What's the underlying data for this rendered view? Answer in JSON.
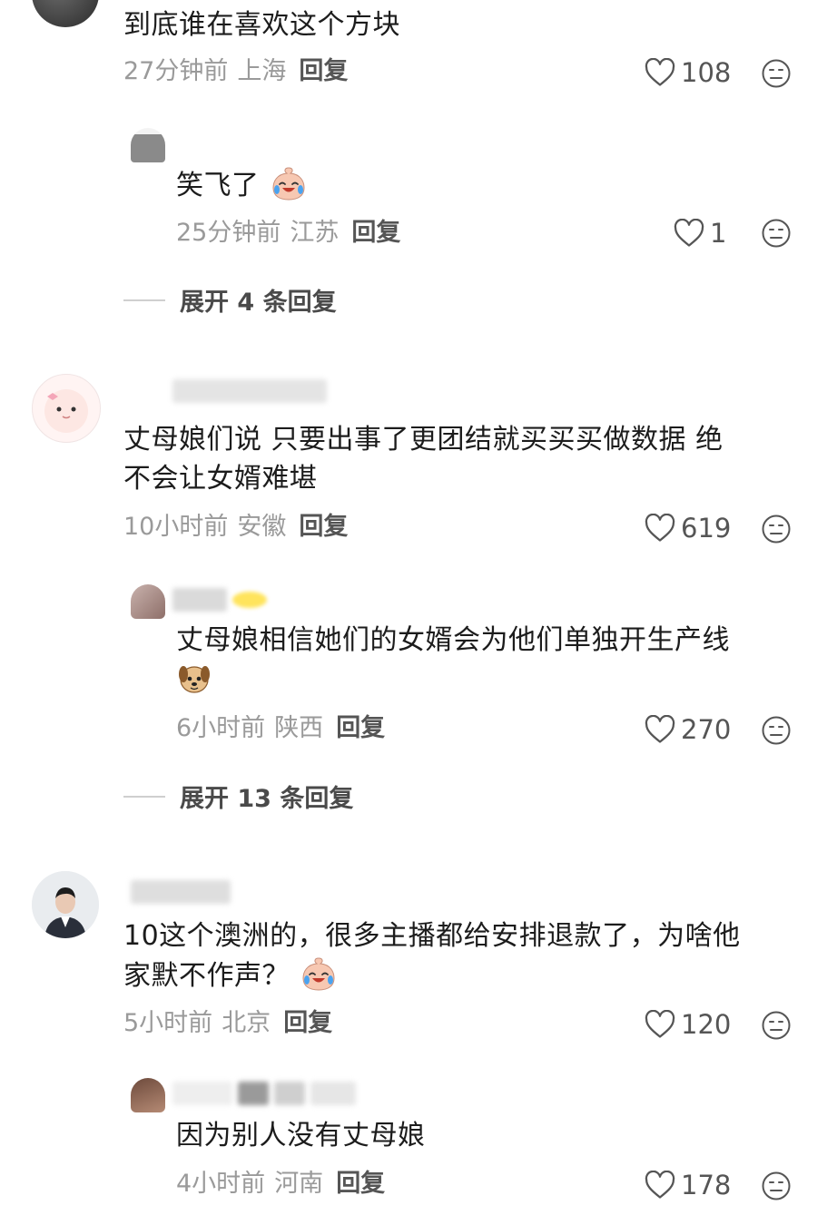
{
  "comments": [
    {
      "text": "到底谁在喜欢这个方块",
      "time": "27分钟前",
      "location": "上海",
      "reply_label": "回复",
      "likes": "108",
      "replies": [
        {
          "text": "笑飞了",
          "emoji": "laugh-cry-emoji",
          "time": "25分钟前",
          "location": "江苏",
          "reply_label": "回复",
          "likes": "1"
        }
      ],
      "expand_label": "展开 4 条回复"
    },
    {
      "text_line1": "丈母娘们说 只要出事了更团结就买买买做数据 绝",
      "text_line2": "不会让女婿难堪",
      "time": "10小时前",
      "location": "安徽",
      "reply_label": "回复",
      "likes": "619",
      "replies": [
        {
          "text": "丈母娘相信她们的女婿会为他们单独开生产线",
          "emoji": "dog-emoji",
          "time": "6小时前",
          "location": "陕西",
          "reply_label": "回复",
          "likes": "270"
        }
      ],
      "expand_label": "展开 13 条回复"
    },
    {
      "text_line1": "10这个澳洲的，很多主播都给安排退款了，为啥他",
      "text_line2": "家默不作声？",
      "emoji": "laugh-cry-emoji",
      "time": "5小时前",
      "location": "北京",
      "reply_label": "回复",
      "likes": "120",
      "replies": [
        {
          "text": "因为别人没有丈母娘",
          "time": "4小时前",
          "location": "河南",
          "reply_label": "回复",
          "likes": "178"
        }
      ]
    }
  ],
  "icons": {
    "like": "heart-outline-icon",
    "dislike": "neutral-face-icon"
  },
  "colors": {
    "meta": "#9a9a9a",
    "reply": "#555555",
    "text": "#1c1c1c"
  }
}
